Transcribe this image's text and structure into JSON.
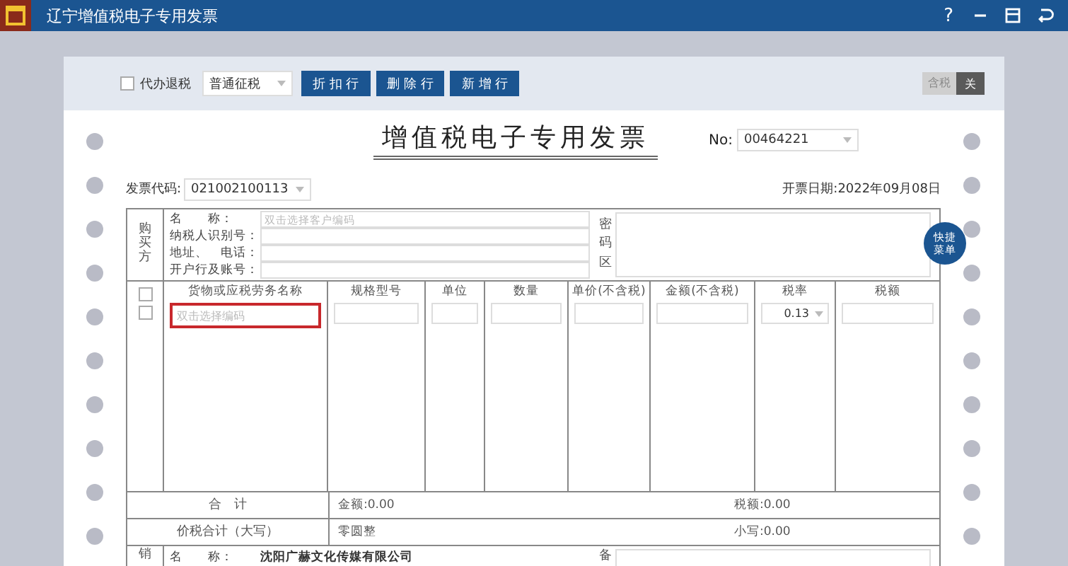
{
  "window": {
    "title": "辽宁增值税电子专用发票",
    "help": "?"
  },
  "toolbar": {
    "agent_refund": {
      "label": "代办退税",
      "checked": false
    },
    "tax_mode": {
      "value": "普通征税"
    },
    "buttons": [
      "折 扣 行",
      "删 除 行",
      "新 增 行"
    ],
    "tax_inclusive": {
      "label": "含税",
      "value": "关",
      "on": false
    }
  },
  "invoice": {
    "title": "增值税电子专用发票",
    "number_label": "No:",
    "number": "00464221",
    "code_label": "发票代码:",
    "code": "021002100113",
    "date": "开票日期:2022年09月08日"
  },
  "buyer": {
    "side_label": "购买方",
    "fields": [
      {
        "label": "名　　称：",
        "placeholder": "双击选择客户编码"
      },
      {
        "label": "纳税人识别号："
      },
      {
        "label": "地址、　电话："
      },
      {
        "label": "开户行及账号："
      }
    ],
    "password_area_label": "密码区"
  },
  "quick_menu": "快捷菜单",
  "items": {
    "select_all_checked": false,
    "columns": [
      "货物或应税劳务名称",
      "规格型号",
      "单位",
      "数量",
      "单价(不含税)",
      "金额(不含税)",
      "税率",
      "税额"
    ],
    "rows": [
      {
        "checked": false,
        "name_placeholder": "双击选择编码",
        "rate": "0.13"
      }
    ]
  },
  "totals": [
    {
      "label": "合　计",
      "amount": "金额:0.00",
      "tax": "税额:0.00"
    },
    {
      "label": "价税合计（大写）",
      "amount": "零圆整",
      "tax": "小写:0.00"
    }
  ],
  "seller": {
    "side_label": "销",
    "name_label": "名　　称：",
    "name": "沈阳广赫文化传媒有限公司",
    "remarks_label": "备"
  }
}
